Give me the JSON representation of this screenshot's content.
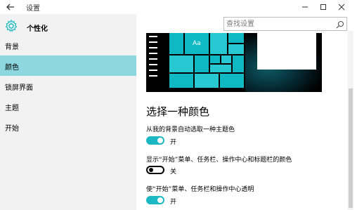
{
  "window": {
    "title": "设置",
    "controls": [
      "minimize",
      "maximize",
      "close"
    ]
  },
  "sidebar": {
    "title": "个性化",
    "items": [
      {
        "label": "背景",
        "selected": false
      },
      {
        "label": "颜色",
        "selected": true
      },
      {
        "label": "锁屏界面",
        "selected": false
      },
      {
        "label": "主题",
        "selected": false
      },
      {
        "label": "开始",
        "selected": false
      }
    ]
  },
  "search": {
    "placeholder": "查找设置"
  },
  "preview": {
    "tile_label": "Aa"
  },
  "main": {
    "section_title": "选择一种颜色",
    "settings": [
      {
        "label": "从我的背景自动选取一种主题色",
        "state": "开",
        "on": true
      },
      {
        "label": "显示“开始”菜单、任务栏、操作中心和标题栏的颜色",
        "state": "关",
        "on": false
      },
      {
        "label": "使“开始”菜单、任务栏和操作中心透明",
        "state": "开",
        "on": true
      }
    ]
  },
  "colors": {
    "accent": "#1bb8c4",
    "selected_bg": "#8dd8e0",
    "sidebar_bg": "#f2f2f2"
  },
  "icons": [
    "back-arrow-icon",
    "gear-icon",
    "search-icon",
    "minimize-icon",
    "maximize-icon",
    "close-icon"
  ]
}
